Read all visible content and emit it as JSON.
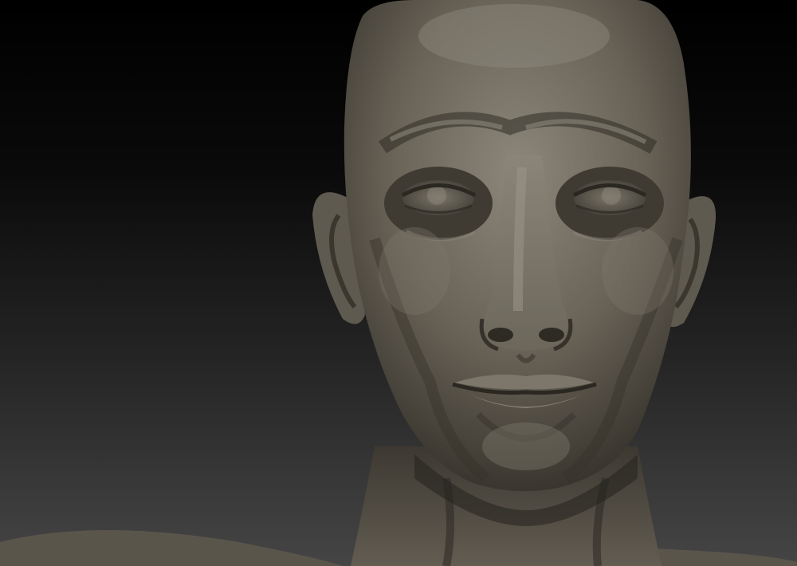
{
  "scene": {
    "background_top": "#000000",
    "background_bottom": "#454545",
    "skin_color": "#6a6458",
    "skin_highlight": "#8c877b",
    "skin_shadow": "#2a2722"
  }
}
